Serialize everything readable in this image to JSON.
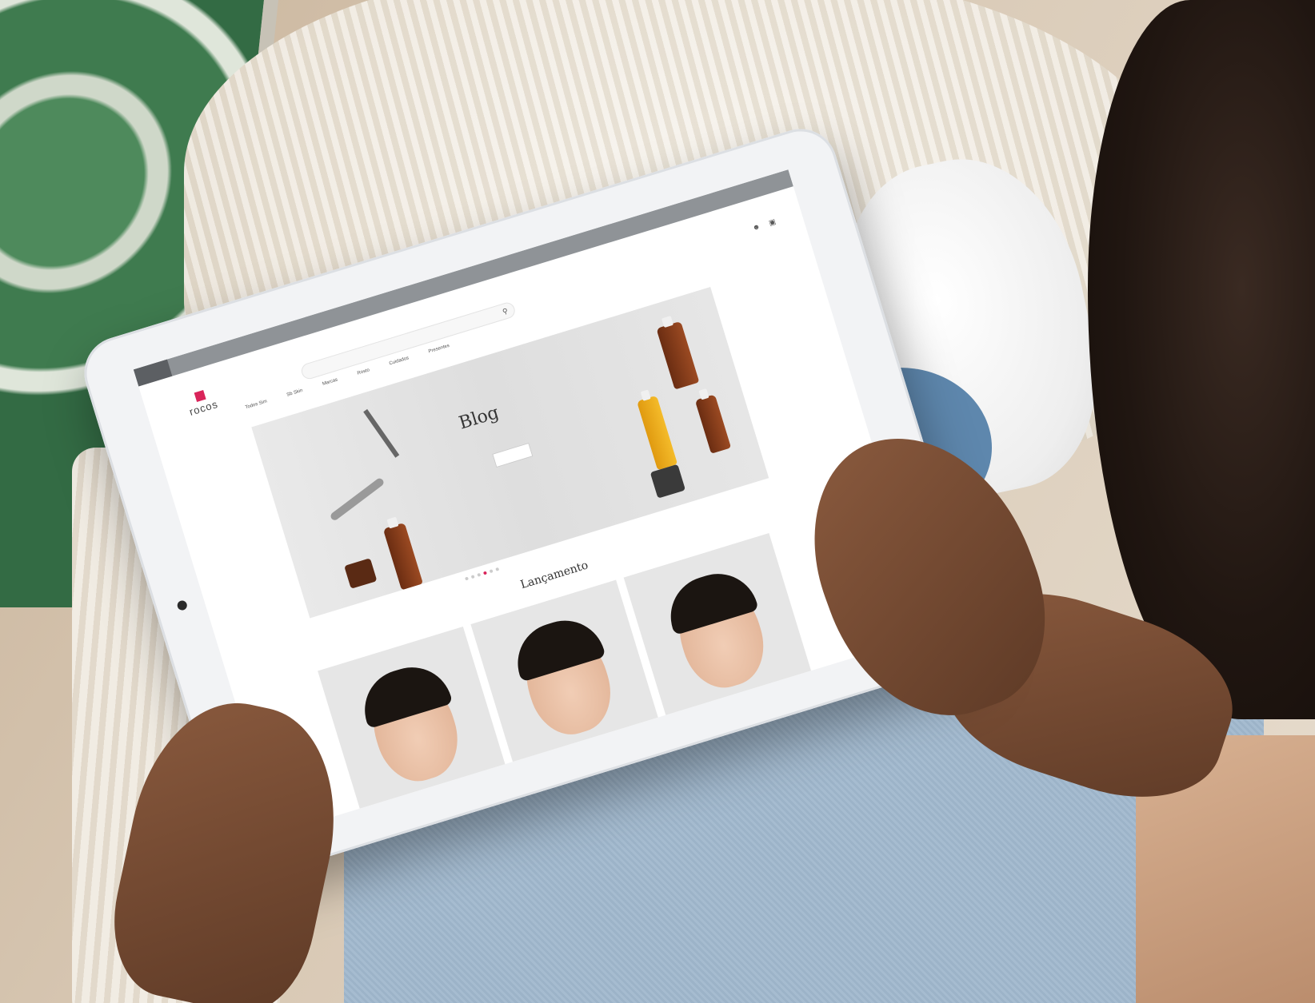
{
  "browser": {
    "logo_label": "",
    "tab_labels": [
      "",
      ""
    ],
    "promo_text": "",
    "promo_highlight": ""
  },
  "header": {
    "utility_links": [
      "",
      "",
      ""
    ],
    "logo_name": "rocos",
    "search_placeholder": "",
    "nav_items": [
      "Todos Sim",
      "Sb Skin",
      "Marcas",
      "Rosto",
      "Cuidados",
      "Presentes"
    ],
    "left_link": ""
  },
  "hero": {
    "title": "Blog",
    "subtitle": "",
    "button_label": "",
    "code_text": ""
  },
  "section": {
    "title": "Lançamento"
  },
  "colors": {
    "accent": "#d9245a",
    "whatsapp": "#2cb742",
    "browser_bar": "#8f9397"
  },
  "icons": [
    "search-icon",
    "user-icon",
    "cart-icon",
    "whatsapp-icon"
  ],
  "carousel": {
    "slides": 6,
    "active": 4
  }
}
